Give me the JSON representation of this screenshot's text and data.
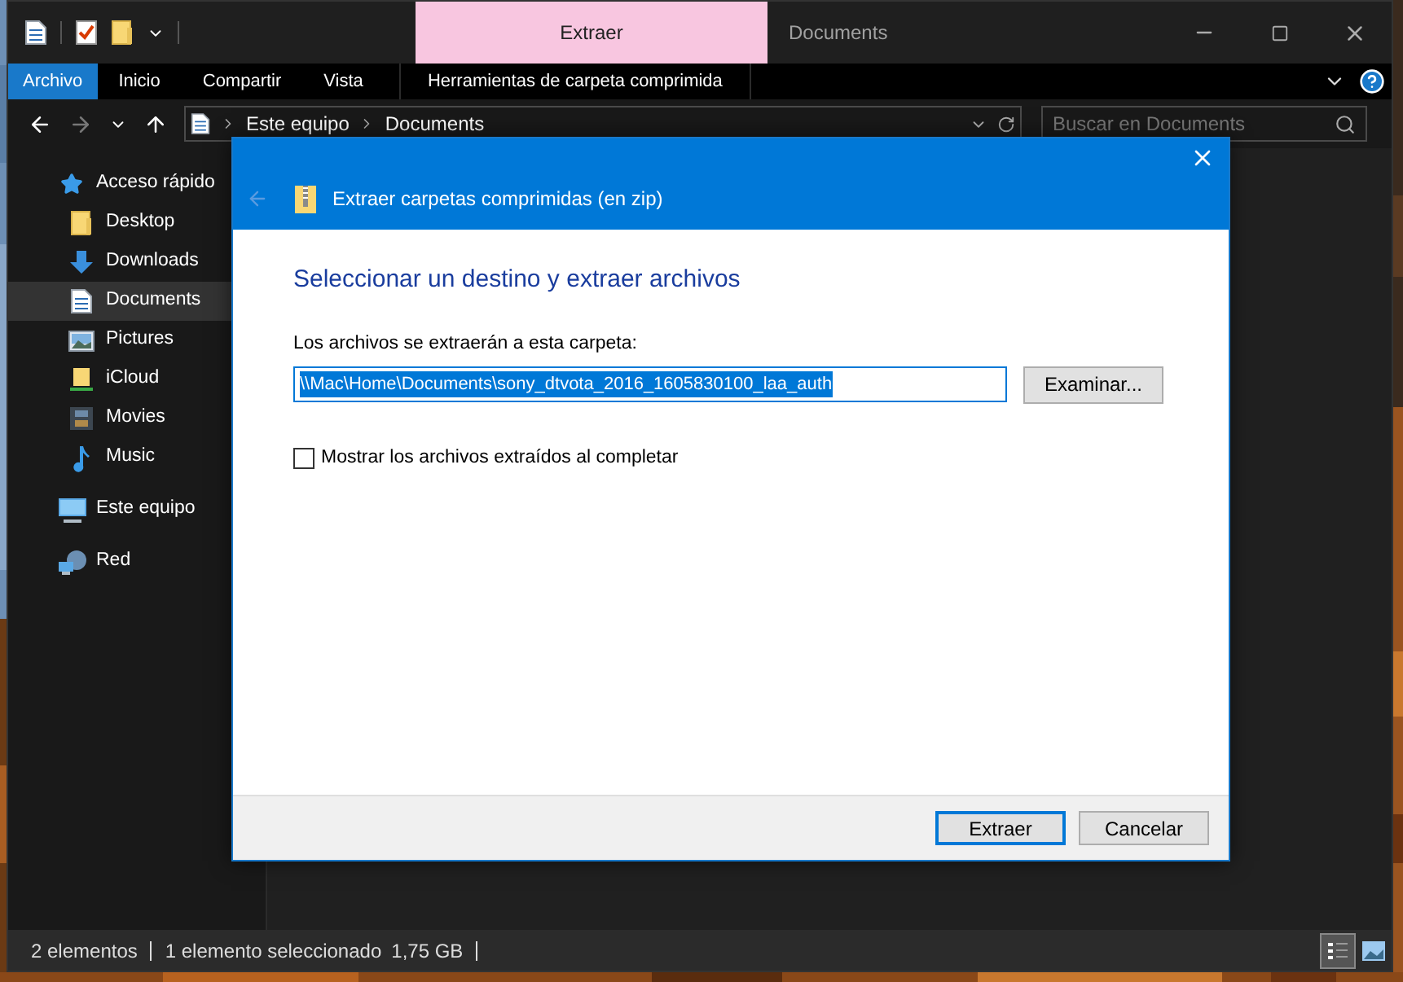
{
  "title_bar": {
    "context_group": "Extraer",
    "title": "Documents"
  },
  "ribbon_tabs": [
    {
      "label": "Archivo",
      "kind": "file"
    },
    {
      "label": "Inicio",
      "kind": "tab"
    },
    {
      "label": "Compartir",
      "kind": "tab"
    },
    {
      "label": "Vista",
      "kind": "tab"
    },
    {
      "label": "Herramientas de carpeta comprimida",
      "kind": "context"
    }
  ],
  "address_bar": {
    "path": [
      "Este equipo",
      "Documents"
    ]
  },
  "search": {
    "placeholder": "Buscar en Documents"
  },
  "sidebar": {
    "items": [
      {
        "label": "Acceso rápido",
        "selected": false,
        "children": [
          {
            "label": "Desktop",
            "selected": false
          },
          {
            "label": "Downloads",
            "selected": false
          },
          {
            "label": "Documents",
            "selected": true
          },
          {
            "label": "Pictures",
            "selected": false
          },
          {
            "label": "iCloud",
            "selected": false
          },
          {
            "label": "Movies",
            "selected": false
          },
          {
            "label": "Music",
            "selected": false
          }
        ]
      },
      {
        "label": "Este equipo",
        "selected": false
      },
      {
        "label": "Red",
        "selected": false
      }
    ]
  },
  "dialog": {
    "title": "Extraer carpetas comprimidas (en zip)",
    "heading": "Seleccionar un destino y extraer archivos",
    "field_label": "Los archivos se extraerán a esta carpeta:",
    "path_value": "\\\\Mac\\Home\\Documents\\sony_dtvota_2016_1605830100_laa_auth",
    "path_highlighted": true,
    "browse_button": "Examinar...",
    "checkbox": {
      "label": "Mostrar los archivos extraídos al completar",
      "checked": false
    },
    "buttons": [
      {
        "label": "Extraer",
        "default": true
      },
      {
        "label": "Cancelar",
        "default": false
      }
    ]
  },
  "status_bar": {
    "items": [
      "2 elementos",
      "1 elemento seleccionado",
      "1,75 GB"
    ],
    "views": [
      {
        "kind": "details",
        "selected": true
      },
      {
        "kind": "large-icons",
        "selected": false
      }
    ]
  }
}
